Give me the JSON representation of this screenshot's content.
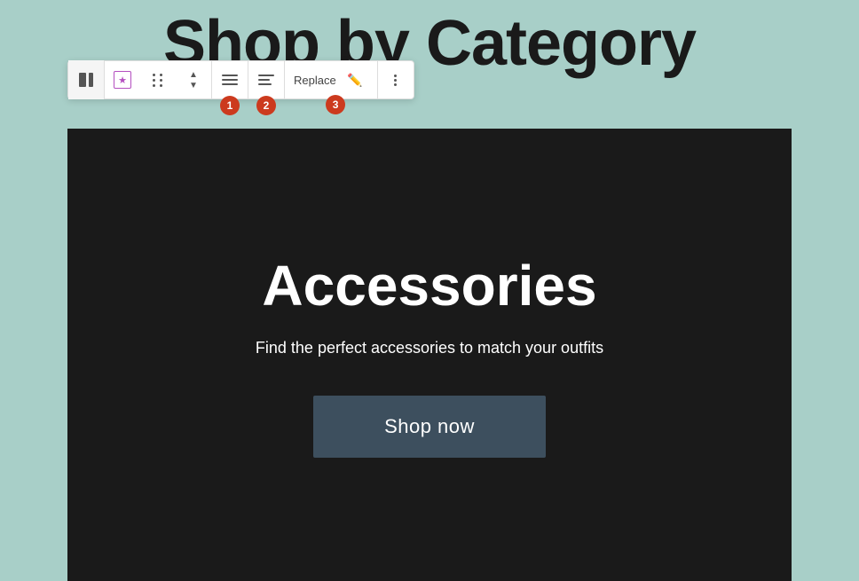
{
  "page": {
    "background_color": "#a8cfc8",
    "title": "Shop by Category"
  },
  "toolbar": {
    "buttons": [
      {
        "id": "two-panel",
        "label": "Two panel view"
      },
      {
        "id": "favorites",
        "label": "Favorites"
      },
      {
        "id": "drag",
        "label": "Drag"
      },
      {
        "id": "move-up",
        "label": "Move up"
      },
      {
        "id": "move-down",
        "label": "Move down"
      },
      {
        "id": "align-full",
        "label": "Align full"
      },
      {
        "id": "align-left",
        "label": "Align left"
      },
      {
        "id": "replace",
        "label": "Replace"
      },
      {
        "id": "edit",
        "label": "Edit"
      },
      {
        "id": "more",
        "label": "More options"
      }
    ],
    "replace_label": "Replace",
    "badges": [
      {
        "number": "1",
        "position": "align-full"
      },
      {
        "number": "2",
        "position": "align-left"
      },
      {
        "number": "3",
        "position": "replace"
      }
    ]
  },
  "content": {
    "category_title": "Accessories",
    "category_description": "Find the perfect accessories to match your outfits",
    "button_label": "Shop now"
  }
}
